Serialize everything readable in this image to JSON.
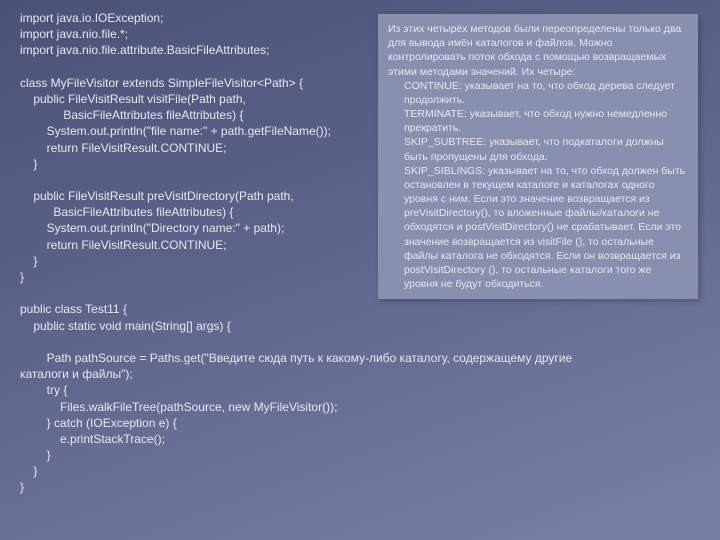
{
  "code": "import java.io.IOException;\nimport java.nio.file.*;\nimport java.nio.file.attribute.BasicFileAttributes;\n\nclass MyFileVisitor extends SimpleFileVisitor<Path> {\n    public FileVisitResult visitFile(Path path,\n             BasicFileAttributes fileAttributes) {\n        System.out.println(\"file name:\" + path.getFileName());\n        return FileVisitResult.CONTINUE;\n    }\n\n    public FileVisitResult preVisitDirectory(Path path,\n          BasicFileAttributes fileAttributes) {\n        System.out.println(\"Directory name:\" + path);\n        return FileVisitResult.CONTINUE;\n    }\n}\n\npublic class Test11 {\n    public static void main(String[] args) {\n\n        Path pathSource = Paths.get(\"Введите сюда путь к какому-либо каталогу, содержащему другие\nкаталоги и файлы\");\n        try {\n            Files.walkFileTree(pathSource, new MyFileVisitor());\n        } catch (IOException e) {\n            e.printStackTrace();\n        }\n    }\n}",
  "info": {
    "p1": "Из этих четырёх методов были переопределены только два для вывода имён каталогов и файлов. Можно контролировать поток обхода с помощью возвращаемых этими методами значений. Их четыре:",
    "p2": "CONTINUE: указывает на то, что обход дерева следует продолжить.",
    "p3": "TERMINATE: указывает, что обход нужно немедленно прекратить.",
    "p4": "SKIP_SUBTREE: указывает, что подкаталоги должны быть пропущены для обхода.",
    "p5": "SKIP_SIBLINGS: указывает на то, что обход должен быть остановлен в текущем каталоге и каталогах одного уровня с ним. Если это значение возвращается из preVisitDirectory(), то вложенные файлы/каталоги не обходятся и postVisitDirectory() не срабатывает. Если это значение возвращается из visitFile (), то остальные файлы каталога не обходятся. Если он возвращается из postVisitDirectory (), то остальные каталоги того же уровня не будут обходиться."
  }
}
